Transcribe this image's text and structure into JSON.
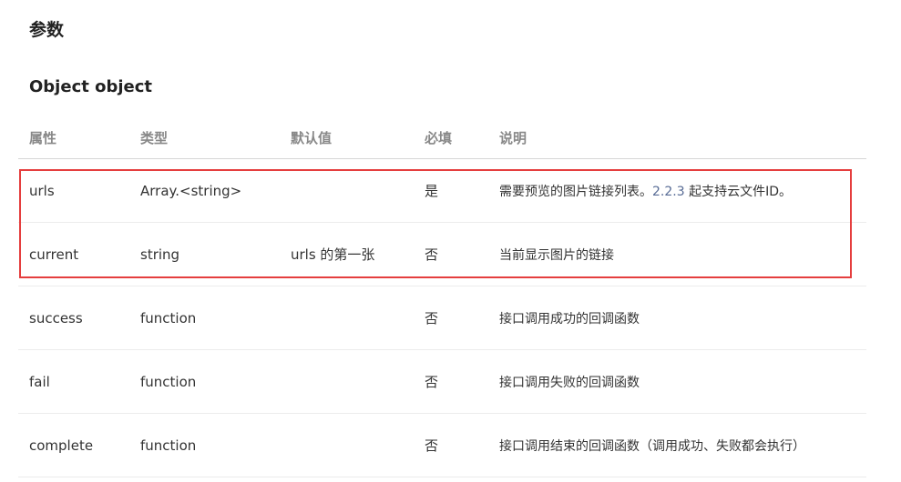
{
  "section_title": "参数",
  "object_title": "Object object",
  "table": {
    "headers": {
      "prop": "属性",
      "type": "类型",
      "default": "默认值",
      "required": "必填",
      "desc": "说明"
    },
    "rows": [
      {
        "prop": "urls",
        "type": "Array.<string>",
        "default": "",
        "required": "是",
        "desc_before": "需要预览的图片链接列表。",
        "desc_link": "2.2.3",
        "desc_after": " 起支持云文件ID。"
      },
      {
        "prop": "current",
        "type": "string",
        "default": "urls 的第一张",
        "required": "否",
        "desc": "当前显示图片的链接"
      },
      {
        "prop": "success",
        "type": "function",
        "default": "",
        "required": "否",
        "desc": "接口调用成功的回调函数"
      },
      {
        "prop": "fail",
        "type": "function",
        "default": "",
        "required": "否",
        "desc": "接口调用失败的回调函数"
      },
      {
        "prop": "complete",
        "type": "function",
        "default": "",
        "required": "否",
        "desc": "接口调用结束的回调函数（调用成功、失败都会执行）"
      }
    ]
  },
  "colors": {
    "highlight_border": "#e53e3e",
    "link": "#576b95",
    "header_text": "#888888"
  }
}
